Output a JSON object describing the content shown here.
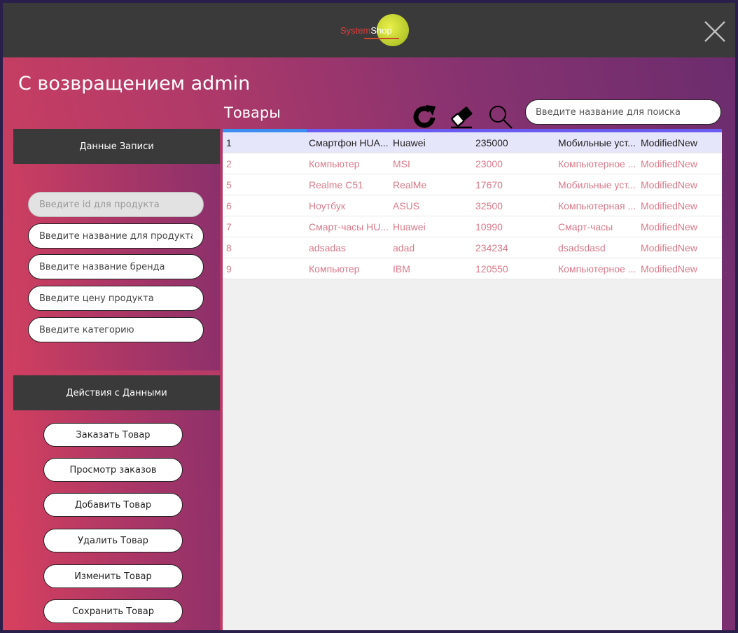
{
  "titlebar": {
    "logo_text_a": "System",
    "logo_text_b": "Shop"
  },
  "welcome": "С возвращением admin",
  "products_title": "Товары",
  "toolbar": {
    "refresh_icon": "refresh-icon",
    "clear_icon": "eraser-icon",
    "search_icon": "search-icon"
  },
  "search": {
    "placeholder": "Введите название для поиска"
  },
  "data_panel": {
    "title": "Данные Записи",
    "fields": {
      "id": "Введите id для продукта",
      "name": "Введите название для продукта",
      "brand": "Введите название бренда",
      "price": "Введите цену продукта",
      "category": "Введите категорию"
    }
  },
  "actions_panel": {
    "title": "Действия с Данными",
    "buttons": {
      "order": "Заказать Товар",
      "view_orders": "Просмотр заказов",
      "add": "Добавить Товар",
      "delete": "Удалить Товар",
      "edit": "Изменить Товар",
      "save": "Сохранить Товар"
    }
  },
  "products": [
    {
      "id": "1",
      "name": "Смартфон HUA...",
      "brand": "Huawei",
      "price": "235000",
      "category": "Мобильные уст...",
      "status": "ModifiedNew"
    },
    {
      "id": "2",
      "name": "Компьютер",
      "brand": "MSI",
      "price": "23000",
      "category": "Компьютерное ...",
      "status": "ModifiedNew"
    },
    {
      "id": "5",
      "name": "Realme C51",
      "brand": "RealMe",
      "price": "17670",
      "category": "Мобильные уст...",
      "status": "ModifiedNew"
    },
    {
      "id": "6",
      "name": "Ноутбук",
      "brand": "ASUS",
      "price": "32500",
      "category": "Компьютерная ...",
      "status": "ModifiedNew"
    },
    {
      "id": "7",
      "name": "Смарт-часы HU...",
      "brand": "Huawei",
      "price": "10990",
      "category": "Смарт-часы",
      "status": "ModifiedNew"
    },
    {
      "id": "8",
      "name": "adsadas",
      "brand": "adad",
      "price": "234234",
      "category": "dsadsdasd",
      "status": "ModifiedNew"
    },
    {
      "id": "9",
      "name": "Компьютер",
      "brand": "IBM",
      "price": "120550",
      "category": "Компьютерное ...",
      "status": "ModifiedNew"
    }
  ],
  "colors": {
    "titlebar": "#3a3a3a",
    "gradient_start": "#d6405e",
    "gradient_end": "#6a2c6e",
    "selected_row": "#e6e6fb",
    "row_text": "#d97a8a"
  }
}
